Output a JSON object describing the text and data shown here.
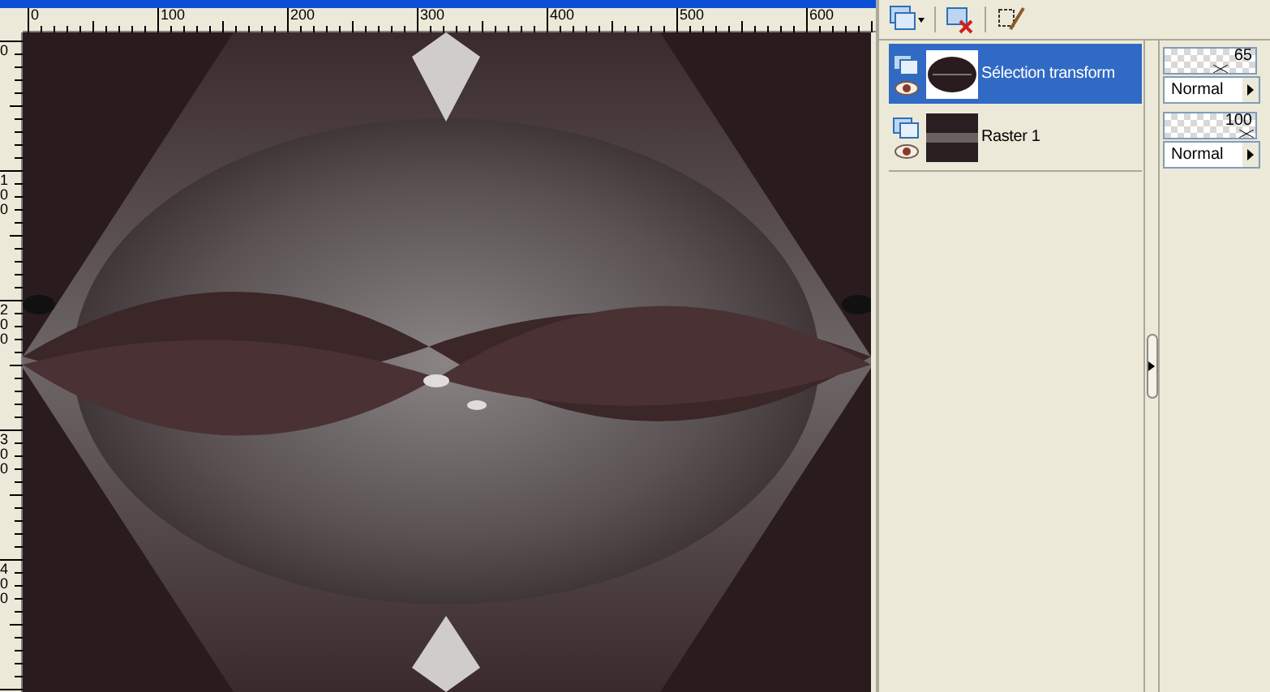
{
  "horizontal_ruler": {
    "labels": [
      "0",
      "100",
      "200",
      "300",
      "400",
      "500",
      "600"
    ]
  },
  "vertical_ruler": {
    "labels": [
      "0",
      "100",
      "200",
      "300",
      "400"
    ]
  },
  "layers": [
    {
      "name": "Sélection transform",
      "selected": true,
      "level": 0.65,
      "opacity": "65",
      "blend_mode": "Normal"
    },
    {
      "name": "Raster 1",
      "selected": false,
      "level": 1,
      "opacity": "100",
      "blend_mode": "Normal"
    }
  ]
}
